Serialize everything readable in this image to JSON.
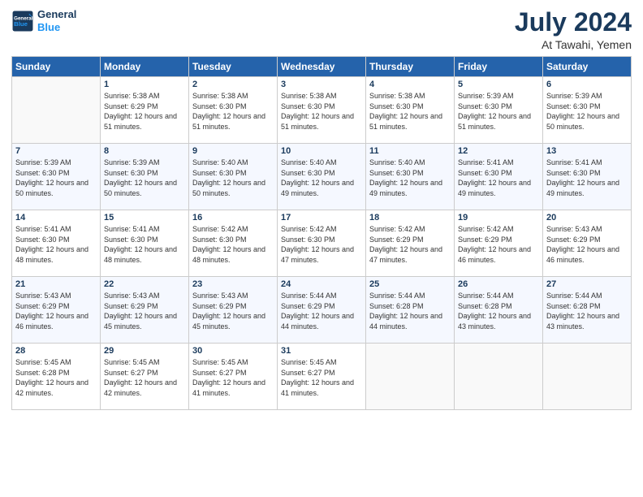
{
  "header": {
    "logo_line1": "General",
    "logo_line2": "Blue",
    "title": "July 2024",
    "subtitle": "At Tawahi, Yemen"
  },
  "weekdays": [
    "Sunday",
    "Monday",
    "Tuesday",
    "Wednesday",
    "Thursday",
    "Friday",
    "Saturday"
  ],
  "weeks": [
    [
      {
        "day": "",
        "empty": true
      },
      {
        "day": "1",
        "rise": "5:38 AM",
        "set": "6:29 PM",
        "daylight": "12 hours and 51 minutes."
      },
      {
        "day": "2",
        "rise": "5:38 AM",
        "set": "6:30 PM",
        "daylight": "12 hours and 51 minutes."
      },
      {
        "day": "3",
        "rise": "5:38 AM",
        "set": "6:30 PM",
        "daylight": "12 hours and 51 minutes."
      },
      {
        "day": "4",
        "rise": "5:38 AM",
        "set": "6:30 PM",
        "daylight": "12 hours and 51 minutes."
      },
      {
        "day": "5",
        "rise": "5:39 AM",
        "set": "6:30 PM",
        "daylight": "12 hours and 51 minutes."
      },
      {
        "day": "6",
        "rise": "5:39 AM",
        "set": "6:30 PM",
        "daylight": "12 hours and 50 minutes."
      }
    ],
    [
      {
        "day": "7",
        "rise": "5:39 AM",
        "set": "6:30 PM",
        "daylight": "12 hours and 50 minutes."
      },
      {
        "day": "8",
        "rise": "5:39 AM",
        "set": "6:30 PM",
        "daylight": "12 hours and 50 minutes."
      },
      {
        "day": "9",
        "rise": "5:40 AM",
        "set": "6:30 PM",
        "daylight": "12 hours and 50 minutes."
      },
      {
        "day": "10",
        "rise": "5:40 AM",
        "set": "6:30 PM",
        "daylight": "12 hours and 49 minutes."
      },
      {
        "day": "11",
        "rise": "5:40 AM",
        "set": "6:30 PM",
        "daylight": "12 hours and 49 minutes."
      },
      {
        "day": "12",
        "rise": "5:41 AM",
        "set": "6:30 PM",
        "daylight": "12 hours and 49 minutes."
      },
      {
        "day": "13",
        "rise": "5:41 AM",
        "set": "6:30 PM",
        "daylight": "12 hours and 49 minutes."
      }
    ],
    [
      {
        "day": "14",
        "rise": "5:41 AM",
        "set": "6:30 PM",
        "daylight": "12 hours and 48 minutes."
      },
      {
        "day": "15",
        "rise": "5:41 AM",
        "set": "6:30 PM",
        "daylight": "12 hours and 48 minutes."
      },
      {
        "day": "16",
        "rise": "5:42 AM",
        "set": "6:30 PM",
        "daylight": "12 hours and 48 minutes."
      },
      {
        "day": "17",
        "rise": "5:42 AM",
        "set": "6:30 PM",
        "daylight": "12 hours and 47 minutes."
      },
      {
        "day": "18",
        "rise": "5:42 AM",
        "set": "6:29 PM",
        "daylight": "12 hours and 47 minutes."
      },
      {
        "day": "19",
        "rise": "5:42 AM",
        "set": "6:29 PM",
        "daylight": "12 hours and 46 minutes."
      },
      {
        "day": "20",
        "rise": "5:43 AM",
        "set": "6:29 PM",
        "daylight": "12 hours and 46 minutes."
      }
    ],
    [
      {
        "day": "21",
        "rise": "5:43 AM",
        "set": "6:29 PM",
        "daylight": "12 hours and 46 minutes."
      },
      {
        "day": "22",
        "rise": "5:43 AM",
        "set": "6:29 PM",
        "daylight": "12 hours and 45 minutes."
      },
      {
        "day": "23",
        "rise": "5:43 AM",
        "set": "6:29 PM",
        "daylight": "12 hours and 45 minutes."
      },
      {
        "day": "24",
        "rise": "5:44 AM",
        "set": "6:29 PM",
        "daylight": "12 hours and 44 minutes."
      },
      {
        "day": "25",
        "rise": "5:44 AM",
        "set": "6:28 PM",
        "daylight": "12 hours and 44 minutes."
      },
      {
        "day": "26",
        "rise": "5:44 AM",
        "set": "6:28 PM",
        "daylight": "12 hours and 43 minutes."
      },
      {
        "day": "27",
        "rise": "5:44 AM",
        "set": "6:28 PM",
        "daylight": "12 hours and 43 minutes."
      }
    ],
    [
      {
        "day": "28",
        "rise": "5:45 AM",
        "set": "6:28 PM",
        "daylight": "12 hours and 42 minutes."
      },
      {
        "day": "29",
        "rise": "5:45 AM",
        "set": "6:27 PM",
        "daylight": "12 hours and 42 minutes."
      },
      {
        "day": "30",
        "rise": "5:45 AM",
        "set": "6:27 PM",
        "daylight": "12 hours and 41 minutes."
      },
      {
        "day": "31",
        "rise": "5:45 AM",
        "set": "6:27 PM",
        "daylight": "12 hours and 41 minutes."
      },
      {
        "day": "",
        "empty": true
      },
      {
        "day": "",
        "empty": true
      },
      {
        "day": "",
        "empty": true
      }
    ]
  ]
}
